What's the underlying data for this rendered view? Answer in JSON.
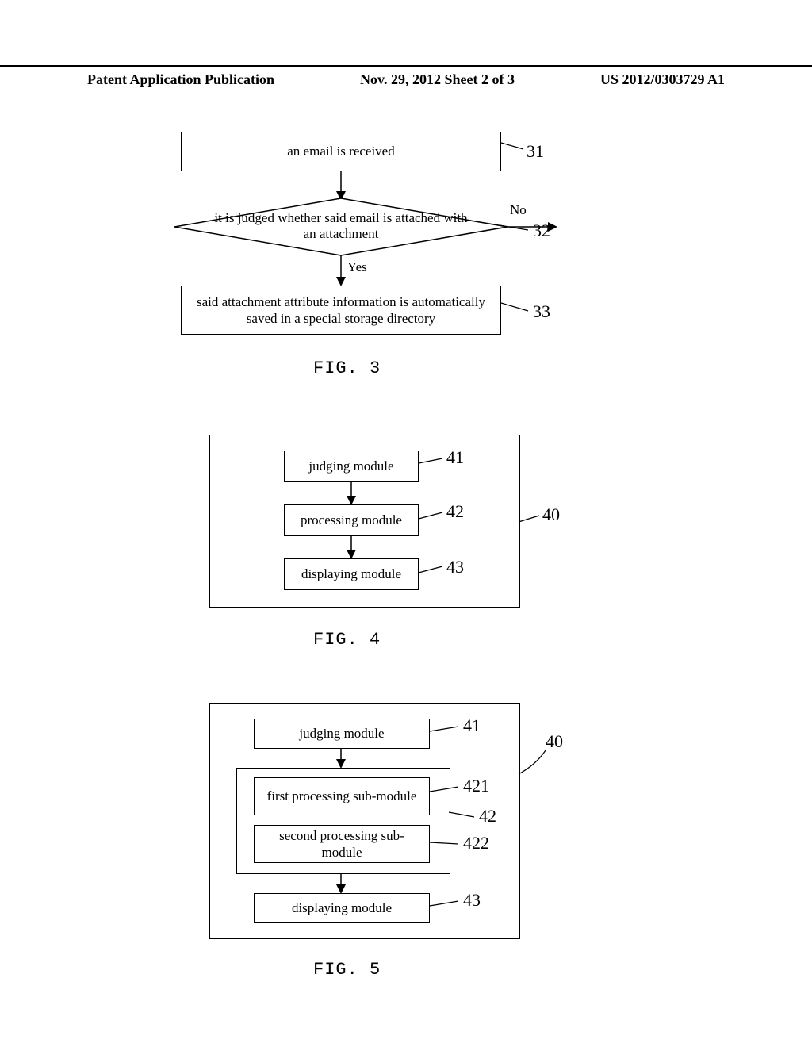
{
  "header": {
    "left": "Patent Application Publication",
    "center": "Nov. 29, 2012  Sheet 2 of 3",
    "right": "US 2012/0303729 A1"
  },
  "fig3": {
    "caption": "FIG. 3",
    "step31": "an email is received",
    "dec32": "it is judged whether said email is attached with an attachment",
    "no": "No",
    "yes": "Yes",
    "step33": "said attachment attribute information is automatically saved in a special storage directory",
    "ref31": "31",
    "ref32": "32",
    "ref33": "33"
  },
  "fig4": {
    "caption": "FIG. 4",
    "m41": "judging module",
    "m42": "processing module",
    "m43": "displaying module",
    "ref41": "41",
    "ref42": "42",
    "ref43": "43",
    "ref40": "40"
  },
  "fig5": {
    "caption": "FIG. 5",
    "m41": "judging module",
    "m421": "first processing sub-module",
    "m422": "second processing sub-module",
    "m43": "displaying module",
    "ref41": "41",
    "ref421": "421",
    "ref42": "42",
    "ref422": "422",
    "ref43": "43",
    "ref40": "40"
  }
}
